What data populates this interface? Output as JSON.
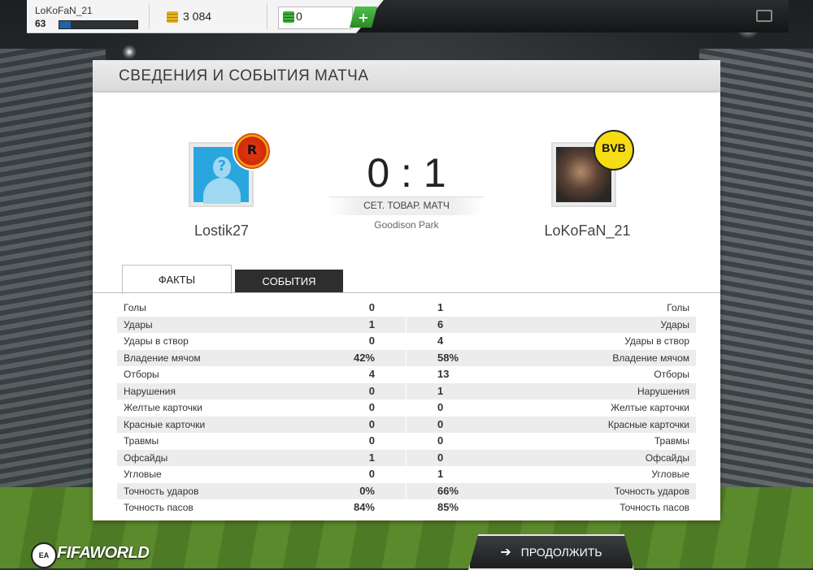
{
  "topbar": {
    "username": "LoKoFaN_21",
    "level": "63",
    "xp_progress": 0.15,
    "coins": "3 084",
    "points": "0",
    "add_label": "+"
  },
  "panel": {
    "title": "СВЕДЕНИЯ И СОБЫТИЯ МАТЧА"
  },
  "match": {
    "home_player": "Lostik27",
    "away_player": "LoKoFaN_21",
    "score": "0 : 1",
    "match_type": "СЕТ. ТОВАР. МАТЧ",
    "stadium": "Goodison Park",
    "home_badge_letter": "R",
    "away_badge_text": "BVB"
  },
  "tabs": {
    "facts": "ФАКТЫ",
    "events": "СОБЫТИЯ"
  },
  "stats": [
    {
      "label": "Голы",
      "home": "0",
      "away": "1"
    },
    {
      "label": "Удары",
      "home": "1",
      "away": "6"
    },
    {
      "label": "Удары в створ",
      "home": "0",
      "away": "4"
    },
    {
      "label": "Владение мячом",
      "home": "42%",
      "away": "58%"
    },
    {
      "label": "Отборы",
      "home": "4",
      "away": "13"
    },
    {
      "label": "Нарушения",
      "home": "0",
      "away": "1"
    },
    {
      "label": "Желтые карточки",
      "home": "0",
      "away": "0"
    },
    {
      "label": "Красные карточки",
      "home": "0",
      "away": "0"
    },
    {
      "label": "Травмы",
      "home": "0",
      "away": "0"
    },
    {
      "label": "Офсайды",
      "home": "1",
      "away": "0"
    },
    {
      "label": "Угловые",
      "home": "0",
      "away": "1"
    },
    {
      "label": "Точность ударов",
      "home": "0%",
      "away": "66%"
    },
    {
      "label": "Точность пасов",
      "home": "84%",
      "away": "85%"
    }
  ],
  "footer": {
    "ea_label": "EA",
    "brand": "FIFAWORLD",
    "continue_label": "ПРОДОЛЖИТЬ"
  },
  "icons": {
    "coins": "coins-icon",
    "points": "points-icon",
    "camera": "camera-icon",
    "arrow": "arrow-right-icon"
  }
}
